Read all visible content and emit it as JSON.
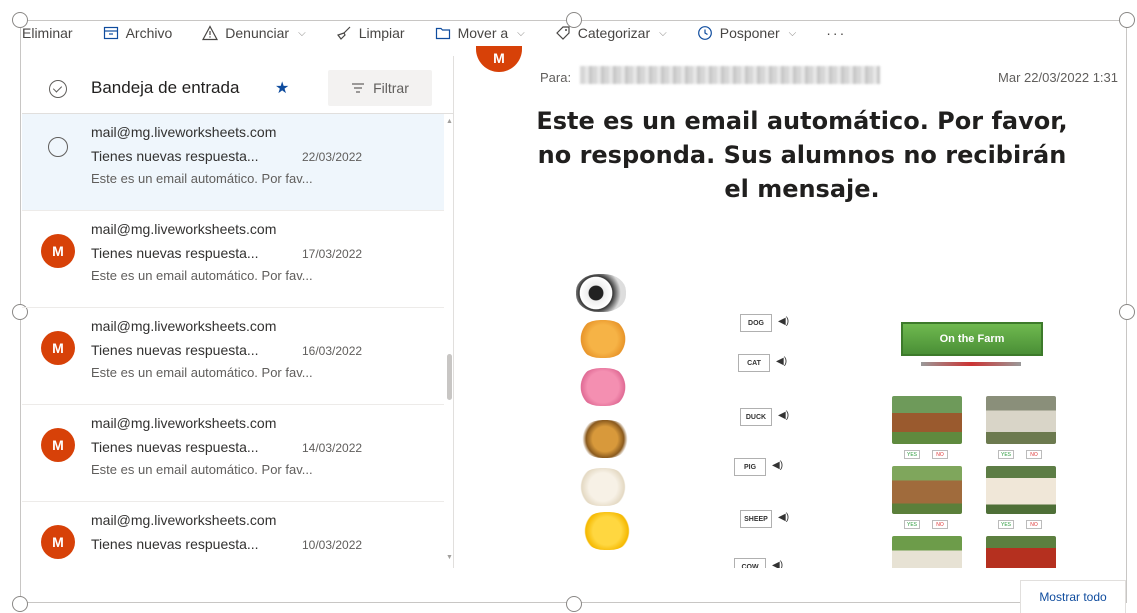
{
  "toolbar": {
    "delete": "Eliminar",
    "archive": "Archivo",
    "report": "Denunciar",
    "sweep": "Limpiar",
    "move_to": "Mover a",
    "categorize": "Categorizar",
    "snooze": "Posponer",
    "more": "···"
  },
  "inbox": {
    "title": "Bandeja de entrada",
    "filter_label": "Filtrar"
  },
  "mails": [
    {
      "from": "mail@mg.liveworksheets.com",
      "subject": "Tienes nuevas respuesta...",
      "date": "22/03/2022",
      "preview": "Este es un email automático. Por fav...",
      "avatar": "",
      "selected": true
    },
    {
      "from": "mail@mg.liveworksheets.com",
      "subject": "Tienes nuevas respuesta...",
      "date": "17/03/2022",
      "preview": "Este es un email automático. Por fav...",
      "avatar": "M",
      "selected": false
    },
    {
      "from": "mail@mg.liveworksheets.com",
      "subject": "Tienes nuevas respuesta...",
      "date": "16/03/2022",
      "preview": "Este es un email automático. Por fav...",
      "avatar": "M",
      "selected": false
    },
    {
      "from": "mail@mg.liveworksheets.com",
      "subject": "Tienes nuevas respuesta...",
      "date": "14/03/2022",
      "preview": "Este es un email automático. Por fav...",
      "avatar": "M",
      "selected": false
    },
    {
      "from": "mail@mg.liveworksheets.com",
      "subject": "Tienes nuevas respuesta...",
      "date": "10/03/2022",
      "preview": "",
      "avatar": "M",
      "selected": false
    }
  ],
  "reading": {
    "avatar": "M",
    "to_label": "Para:",
    "date": "Mar 22/03/2022 1:31",
    "headline": "Este es un email automático. Por favor, no responda. Sus alumnos no recibirán el mensaje.",
    "worksheet": {
      "banner": "On the Farm",
      "words": [
        "DOG",
        "CAT",
        "DUCK",
        "PIG",
        "SHEEP",
        "COW"
      ],
      "yes": "YES",
      "no": "NO"
    }
  },
  "footer": {
    "show_all": "Mostrar todo"
  },
  "colors": {
    "accent": "#0f4c9e",
    "avatar": "#d74108",
    "selected_row": "#eff6fc"
  }
}
